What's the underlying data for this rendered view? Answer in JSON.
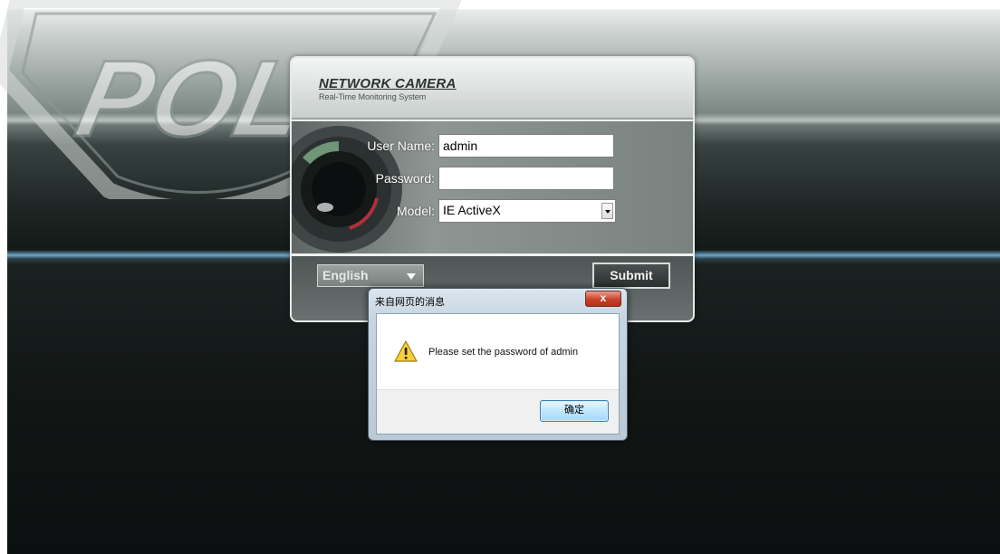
{
  "watermark": {
    "text": "POLICE"
  },
  "login": {
    "brand_title": "NETWORK CAMERA",
    "brand_subtitle": "Real-Time Monitoring System",
    "username_label": "User Name:",
    "username_value": "admin",
    "password_label": "Password:",
    "password_value": "",
    "model_label": "Model:",
    "model_value": "IE ActiveX",
    "language_value": "English",
    "submit_label": "Submit"
  },
  "dialog": {
    "title": "来自网页的消息",
    "close_label": "x",
    "message": "Please set the password of admin",
    "ok_label": "确定",
    "icon": "warning-icon"
  },
  "colors": {
    "dialog_frame": "#c6d5e1",
    "ok_button": "#bee6fd",
    "close_button": "#c7422c",
    "accent_line": "#6ea6c4"
  }
}
